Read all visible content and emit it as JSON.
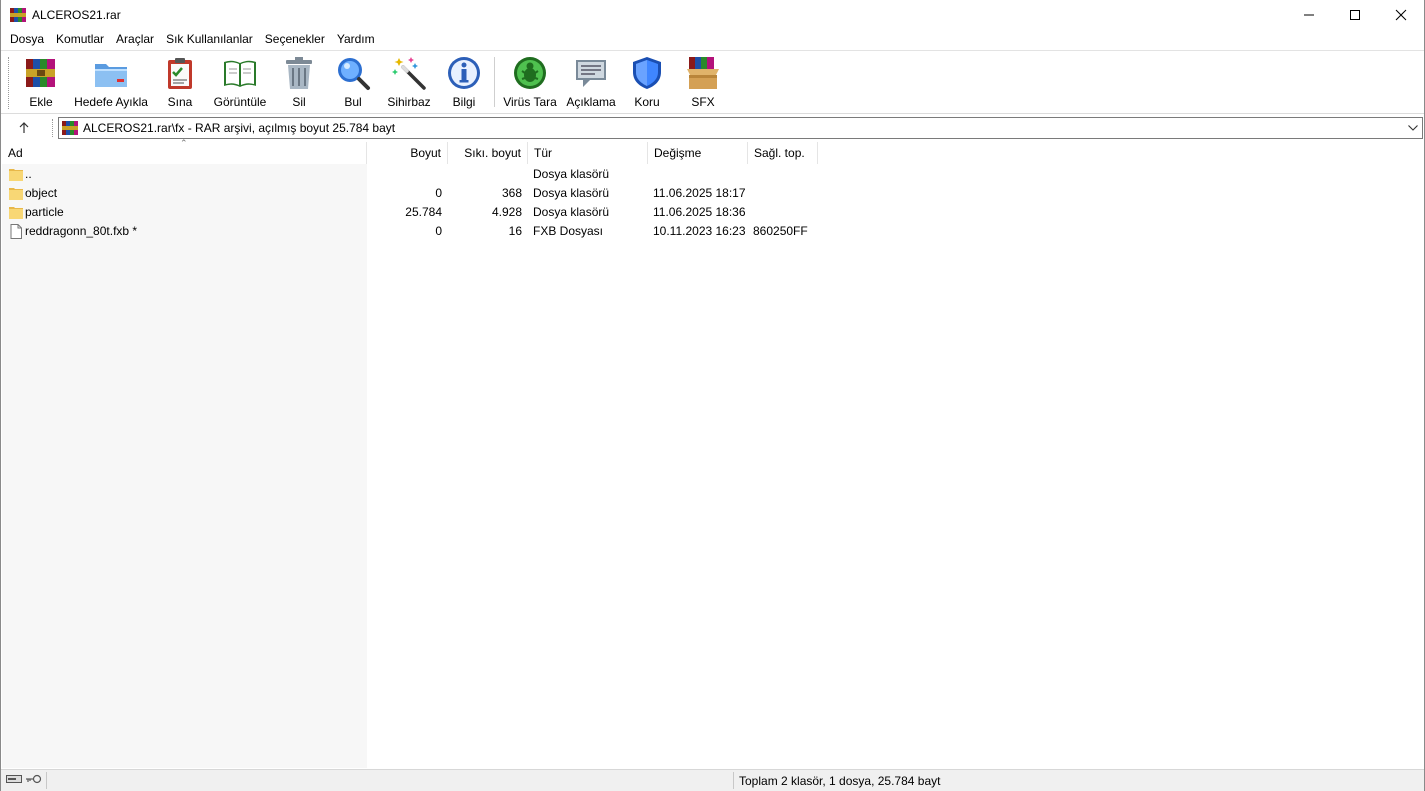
{
  "window": {
    "title": "ALCEROS21.rar",
    "app_icon": "winrar-books-icon"
  },
  "menu": [
    "Dosya",
    "Komutlar",
    "Araçlar",
    "Sık Kullanılanlar",
    "Seçenekler",
    "Yardım"
  ],
  "toolbar": {
    "buttons": [
      {
        "label": "Ekle",
        "icon": "add-archive-icon"
      },
      {
        "label": "Hedefe Ayıkla",
        "icon": "extract-folder-icon"
      },
      {
        "label": "Sına",
        "icon": "test-clipboard-icon"
      },
      {
        "label": "Görüntüle",
        "icon": "view-book-icon"
      },
      {
        "label": "Sil",
        "icon": "trash-icon"
      },
      {
        "label": "Bul",
        "icon": "magnifier-icon"
      },
      {
        "label": "Sihirbaz",
        "icon": "wizard-wand-icon"
      },
      {
        "label": "Bilgi",
        "icon": "info-icon"
      },
      {
        "label": "Virüs Tara",
        "icon": "virus-scan-icon"
      },
      {
        "label": "Açıklama",
        "icon": "comment-icon"
      },
      {
        "label": "Koru",
        "icon": "shield-icon"
      },
      {
        "label": "SFX",
        "icon": "sfx-box-icon"
      }
    ]
  },
  "address": {
    "text": "ALCEROS21.rar\\fx - RAR arşivi, açılmış boyut 25.784 bayt"
  },
  "columns": {
    "name": "Ad",
    "size": "Boyut",
    "packed": "Sıkı. boyut",
    "type": "Tür",
    "modified": "Değişme",
    "crc": "Sağl. top."
  },
  "files": [
    {
      "name": "..",
      "size": "",
      "packed": "",
      "type": "Dosya klasörü",
      "modified": "",
      "crc": "",
      "kind": "folder"
    },
    {
      "name": "object",
      "size": "0",
      "packed": "368",
      "type": "Dosya klasörü",
      "modified": "11.06.2025 18:17",
      "crc": "",
      "kind": "folder"
    },
    {
      "name": "particle",
      "size": "25.784",
      "packed": "4.928",
      "type": "Dosya klasörü",
      "modified": "11.06.2025 18:36",
      "crc": "",
      "kind": "folder"
    },
    {
      "name": "reddragonn_80t.fxb *",
      "size": "0",
      "packed": "16",
      "type": "FXB Dosyası",
      "modified": "10.11.2023 16:23",
      "crc": "860250FF",
      "kind": "file"
    }
  ],
  "status": {
    "summary": "Toplam 2 klasör, 1 dosya, 25.784 bayt"
  }
}
